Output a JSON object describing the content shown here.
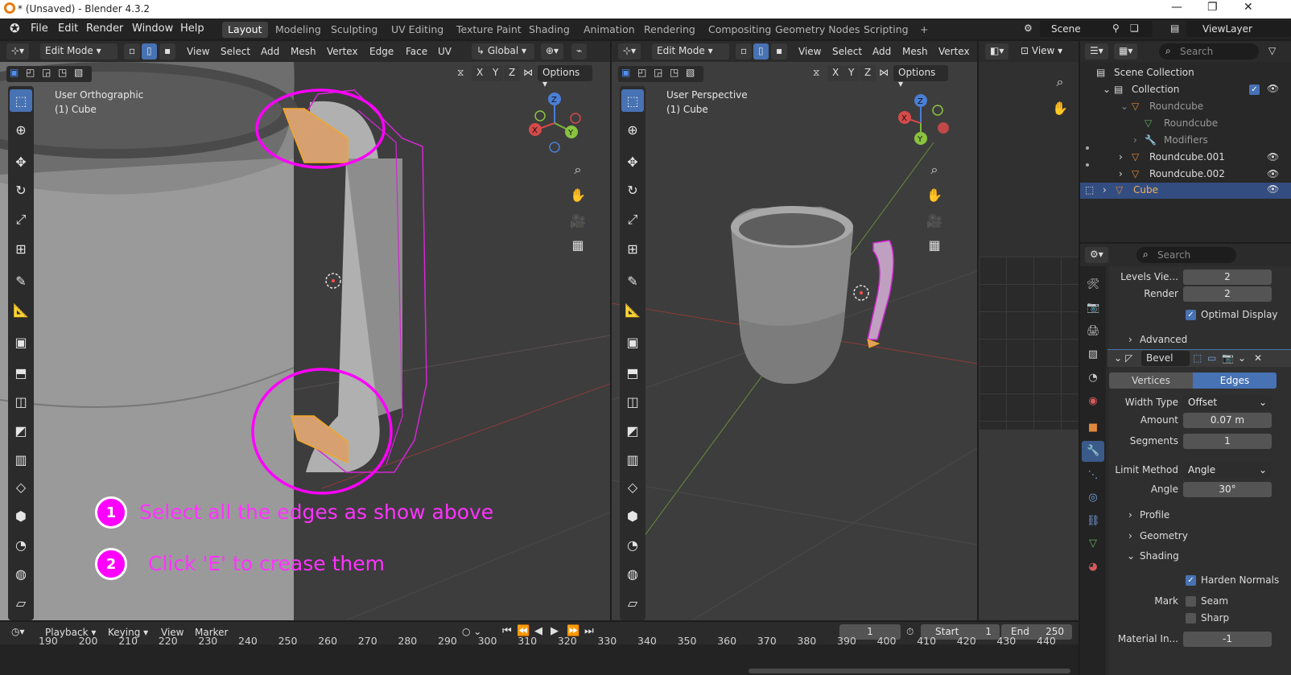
{
  "window": {
    "title": "* (Unsaved) - Blender 4.3.2"
  },
  "menu": [
    "File",
    "Edit",
    "Render",
    "Window",
    "Help"
  ],
  "workspaces": [
    "Layout",
    "Modeling",
    "Sculpting",
    "UV Editing",
    "Texture Paint",
    "Shading",
    "Animation",
    "Rendering",
    "Compositing",
    "Geometry Nodes",
    "Scripting"
  ],
  "scene": {
    "scene_name": "Scene",
    "view_layer": "ViewLayer"
  },
  "left_viewport": {
    "mode": "Edit Mode",
    "menus": [
      "View",
      "Select",
      "Add",
      "Mesh",
      "Vertex",
      "Edge",
      "Face",
      "UV"
    ],
    "orientation": "Global",
    "axes": [
      "X",
      "Y",
      "Z"
    ],
    "options": "Options",
    "view_name": "User Orthographic",
    "object": "(1) Cube"
  },
  "right_viewport": {
    "mode": "Edit Mode",
    "menus": [
      "View",
      "Select",
      "Add",
      "Mesh",
      "Vertex"
    ],
    "axes": [
      "X",
      "Y",
      "Z"
    ],
    "options": "Options",
    "view_name": "User Perspective",
    "object": "(1) Cube"
  },
  "annotations": [
    {
      "num": "1",
      "text": "Select all the edges as show above"
    },
    {
      "num": "2",
      "text": "Click 'E' to crease them"
    }
  ],
  "small_editor": {
    "view": "View"
  },
  "outliner": {
    "search": "Search",
    "root": "Scene Collection",
    "collection": "Collection",
    "items": [
      "Roundcube",
      "Roundcube",
      "Modifiers",
      "Roundcube.001",
      "Roundcube.002",
      "Cube"
    ]
  },
  "properties": {
    "search": "Search",
    "levels_viewport_label": "Levels Vie...",
    "levels_viewport": "2",
    "render_label": "Render",
    "render": "2",
    "optimal_display": "Optimal Display",
    "advanced": "Advanced",
    "modifier_name": "Bevel",
    "tab_vertices": "Vertices",
    "tab_edges": "Edges",
    "width_type_label": "Width Type",
    "width_type": "Offset",
    "amount_label": "Amount",
    "amount": "0.07 m",
    "segments_label": "Segments",
    "segments": "1",
    "limit_method_label": "Limit Method",
    "limit_method": "Angle",
    "angle_label": "Angle",
    "angle": "30°",
    "profile": "Profile",
    "geometry": "Geometry",
    "shading": "Shading",
    "harden_normals": "Harden Normals",
    "mark_label": "Mark",
    "seam": "Seam",
    "sharp": "Sharp",
    "material_label": "Material In...",
    "material": "-1"
  },
  "timeline": {
    "menus": [
      "Playback",
      "Keying",
      "View",
      "Marker"
    ],
    "current_frame": "1",
    "start_label": "Start",
    "start": "1",
    "end_label": "End",
    "end": "250",
    "ticks": [
      "190",
      "200",
      "210",
      "220",
      "230",
      "240",
      "250",
      "260",
      "270",
      "280",
      "290",
      "300",
      "310",
      "320",
      "330",
      "340",
      "350",
      "360",
      "370",
      "380",
      "390",
      "400",
      "410",
      "420",
      "430",
      "440"
    ]
  },
  "colors": {
    "accent": "#4772b3",
    "annotation": "#ff00ff",
    "selection": "#f5a623"
  }
}
